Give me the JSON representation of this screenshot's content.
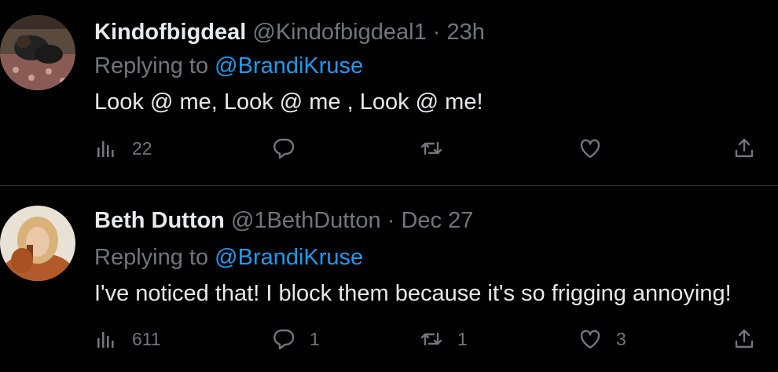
{
  "colors": {
    "background": "#000000",
    "text": "#e7e9ea",
    "muted": "#71767b",
    "mention": "#1d9bf0",
    "divider": "#2f3336"
  },
  "tweets": [
    {
      "display_name": "Kindofbigdeal",
      "handle": "@Kindofbigdeal1",
      "separator": "·",
      "time": "23h",
      "replying_prefix": "Replying to",
      "replying_to": "@BrandiKruse",
      "text": "Look @ me, Look @ me , Look @ me!",
      "views": "22",
      "replies": "",
      "retweets": "",
      "likes": ""
    },
    {
      "display_name": "Beth Dutton",
      "handle": "@1BethDutton",
      "separator": "·",
      "time": "Dec 27",
      "replying_prefix": "Replying to",
      "replying_to": "@BrandiKruse",
      "text": "I've noticed that! I block them because it's so frigging annoying!",
      "views": "611",
      "replies": "1",
      "retweets": "1",
      "likes": "3"
    }
  ],
  "icons": [
    "analytics-icon",
    "reply-icon",
    "retweet-icon",
    "like-icon",
    "share-icon"
  ]
}
